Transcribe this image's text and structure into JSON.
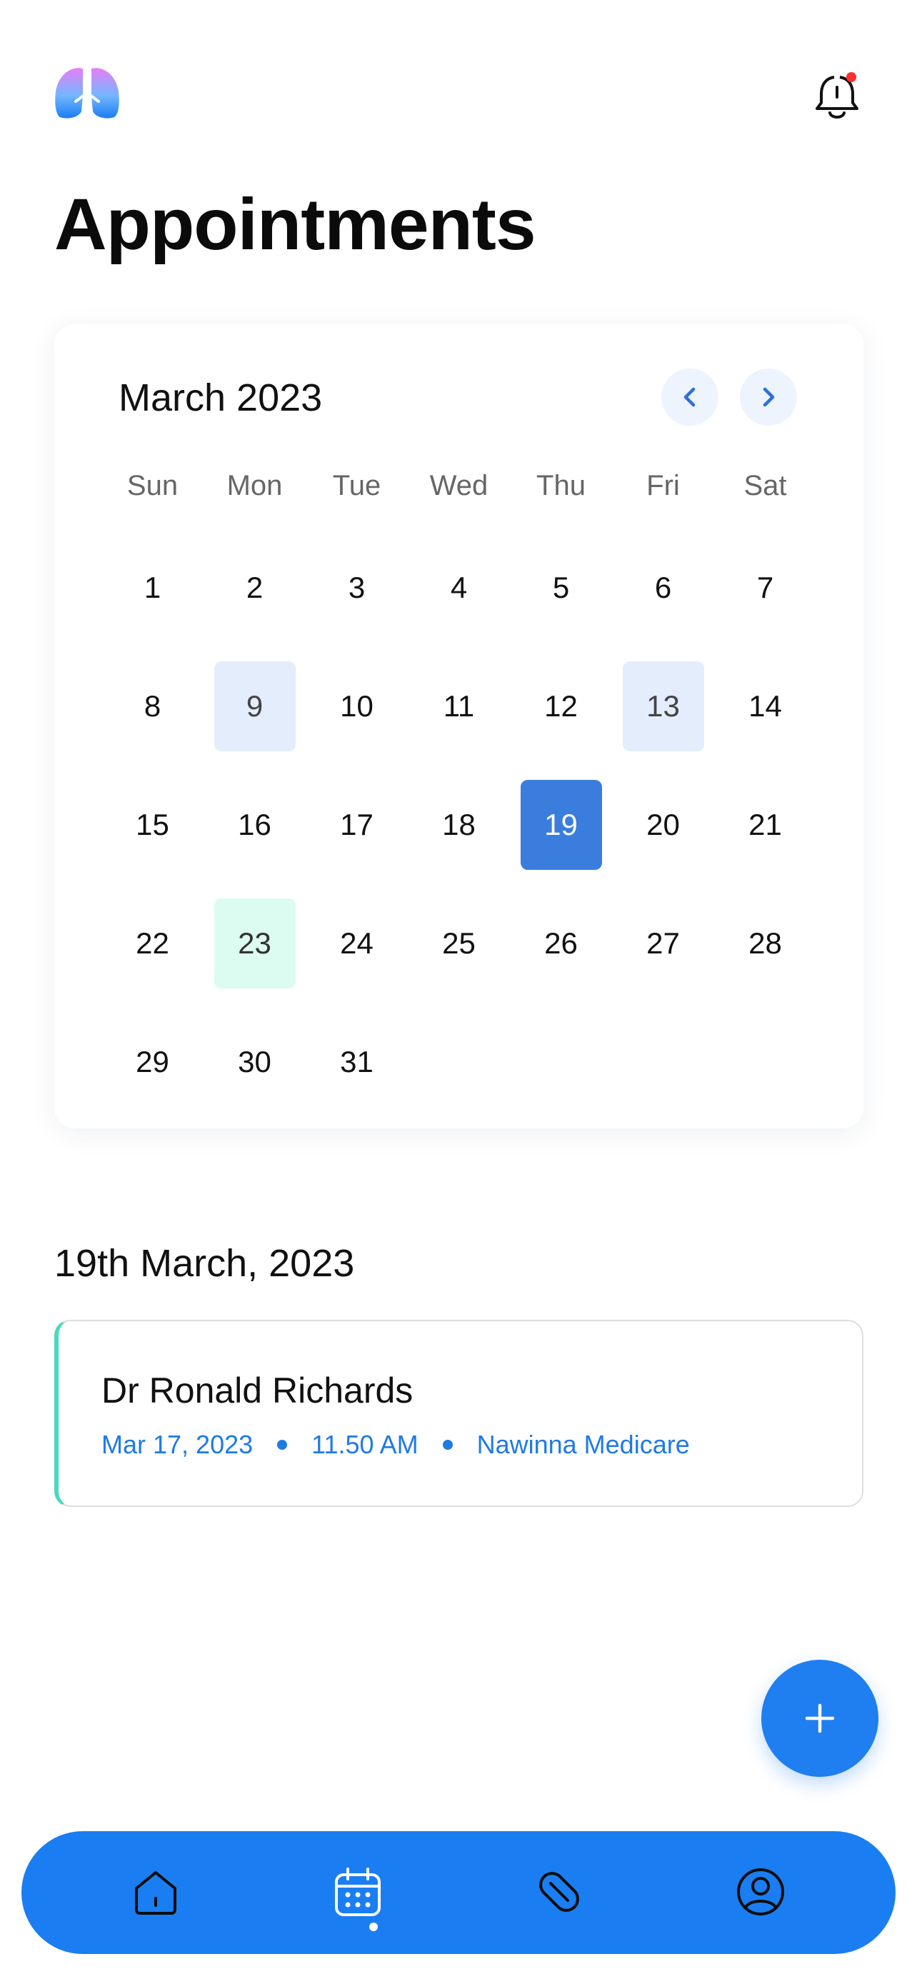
{
  "header": {
    "title": "Appointments",
    "logo_icon": "lungs-icon",
    "notification_icon": "bell-icon",
    "notification_badge_color": "#ff2d2d"
  },
  "calendar": {
    "month_label": "March 2023",
    "prev_icon": "chevron-left-icon",
    "next_icon": "chevron-right-icon",
    "weekdays": [
      "Sun",
      "Mon",
      "Tue",
      "Wed",
      "Thu",
      "Fri",
      "Sat"
    ],
    "days": [
      "1",
      "2",
      "3",
      "4",
      "5",
      "6",
      "7",
      "8",
      "9",
      "10",
      "11",
      "12",
      "13",
      "14",
      "15",
      "16",
      "17",
      "18",
      "19",
      "20",
      "21",
      "22",
      "23",
      "24",
      "25",
      "26",
      "27",
      "28",
      "29",
      "30",
      "31"
    ],
    "selected_day": "19",
    "booked_days": [
      "9",
      "13"
    ],
    "completed_days": [
      "23"
    ],
    "colors": {
      "selected": "#3b7ddd",
      "booked": "#e4edfc",
      "completed": "#dcfbf1"
    }
  },
  "selected_date_label": "19th March, 2023",
  "appointment": {
    "doctor": "Dr Ronald Richards",
    "date": "Mar 17, 2023",
    "time": "11.50 AM",
    "location": "Nawinna Medicare",
    "accent_color": "#4ad9c0"
  },
  "fab": {
    "icon": "plus-icon",
    "color": "#1f7ef0"
  },
  "bottom_nav": {
    "color": "#1a7ef2",
    "active": "calendar",
    "items": [
      {
        "id": "home",
        "icon": "home-icon"
      },
      {
        "id": "calendar",
        "icon": "calendar-icon"
      },
      {
        "id": "medicine",
        "icon": "pill-icon"
      },
      {
        "id": "profile",
        "icon": "user-circle-icon"
      }
    ]
  }
}
